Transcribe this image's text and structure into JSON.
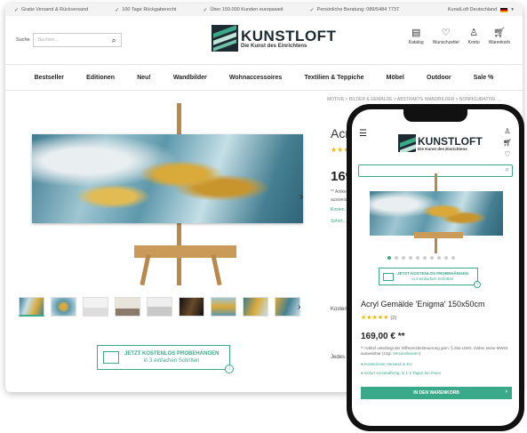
{
  "topbar": {
    "usps": [
      "Gratis Versand & Rückversand",
      "100 Tage Rückgaberecht",
      "Über 150.000 Kunden europaweit",
      "Persönliche Beratung: 089/5484 7737"
    ],
    "country": "KunstLoft Deutschland"
  },
  "header": {
    "search_label": "Suche",
    "search_placeholder": "Suchen...",
    "brand": "KUNSTLOFT",
    "tagline": "Die Kunst des Einrichtens",
    "icons": [
      {
        "icon": "catalog-icon",
        "label": "Katalog"
      },
      {
        "icon": "heart-icon",
        "label": "Wunschzettel"
      },
      {
        "icon": "user-icon",
        "label": "Konto"
      },
      {
        "icon": "cart-icon",
        "label": "Warenkorb"
      }
    ]
  },
  "nav": [
    "Bestseller",
    "Editionen",
    "Neu!",
    "Wandbilder",
    "Wohnaccessoires",
    "Textilien & Teppiche",
    "Möbel",
    "Outdoor",
    "Sale %"
  ],
  "breadcrumb": "MOTIVE  >  BILDER & GEMÄLDE  >  ABSTRAKTE WANDBILDER  >  NONFIGURATIVE …",
  "desktop_product": {
    "title_partial": "Acryl",
    "stars": "★★★★",
    "price_partial": "169,0",
    "vat_partial": "** Artikel u… ausweisbar",
    "stock1": "Kosten…",
    "stock2": "Sofort…",
    "misc1": "Kosten… und F…",
    "misc2": "Jedes Exe… 150x50cm"
  },
  "cta": {
    "line1": "JETZT KOSTENLOS PROBEHÄNGEN",
    "line2": "in 3 einfachen Schritten"
  },
  "mobile": {
    "title": "Acryl Gemälde 'Enigma' 150x50cm",
    "stars": "★★★★★",
    "rating_count": "(2)",
    "price": "169,00 € **",
    "vat_text": "** Artikel unterliegt der Differenzbesteuerung gem. § 25a UStG. Daher keine MWSt. ausweisbar (zzgl.",
    "vat_link": "Versandkosten",
    "vat_end": ")",
    "stock1": "Kostenloser Versand in EU",
    "stock2": "Sofort versandfertig, in 1-3 Tagen bei Ihnen",
    "cart_button": "IN DEN WARENKORB"
  },
  "colors": {
    "accent": "#3aa98a",
    "star": "#f2b600",
    "brand_dark": "#1d2a32"
  }
}
